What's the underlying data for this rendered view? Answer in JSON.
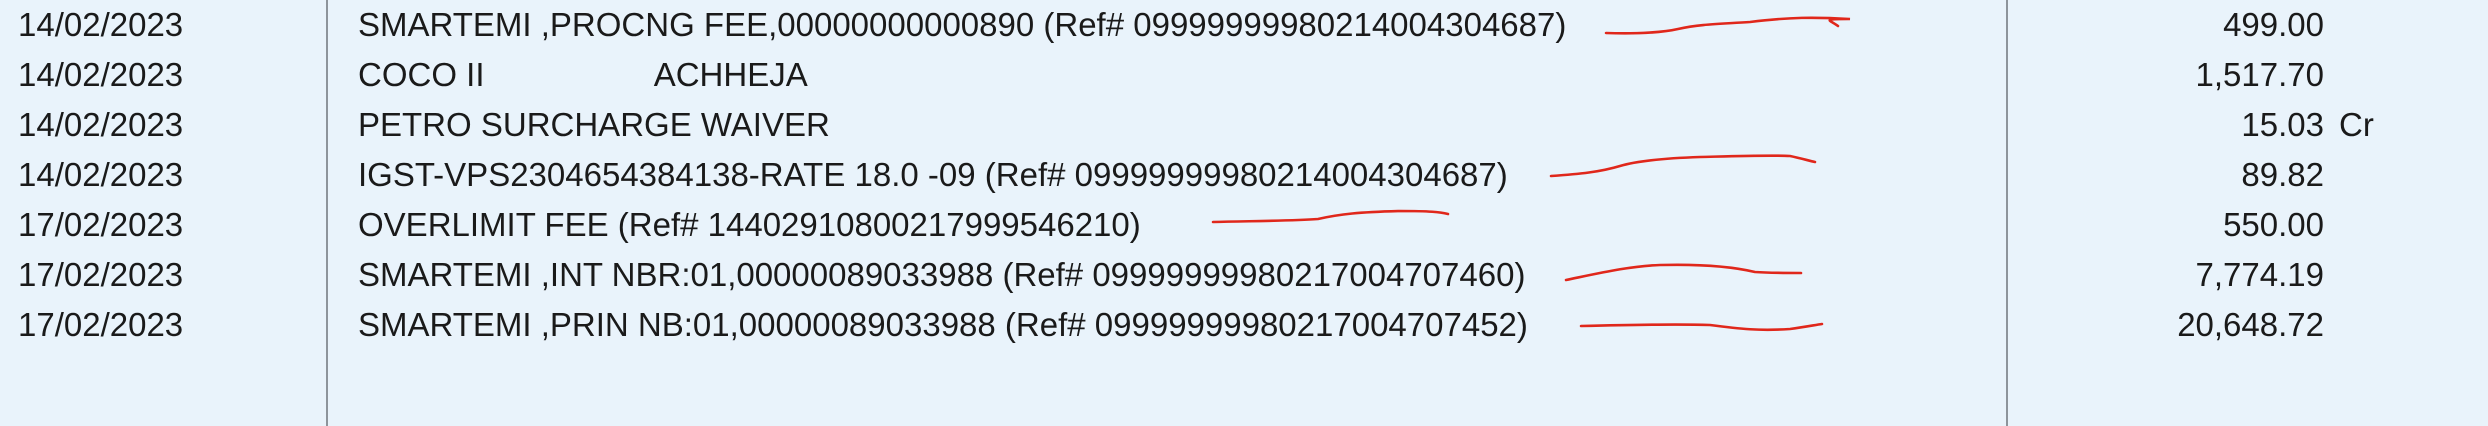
{
  "transactions": [
    {
      "date": "14/02/2023",
      "description": "SMARTEMI ,PROCNG FEE,00000000000890 (Ref# 09999999980214004304687)",
      "description_extra": "",
      "amount": "499.00",
      "cr_dr": ""
    },
    {
      "date": "14/02/2023",
      "description": "COCO II",
      "description_extra": "ACHHEJA",
      "amount": "1,517.70",
      "cr_dr": ""
    },
    {
      "date": "14/02/2023",
      "description": "PETRO SURCHARGE WAIVER",
      "description_extra": "",
      "amount": "15.03",
      "cr_dr": "Cr"
    },
    {
      "date": "14/02/2023",
      "description": "IGST-VPS2304654384138-RATE 18.0 -09 (Ref# 09999999980214004304687)",
      "description_extra": "",
      "amount": "89.82",
      "cr_dr": ""
    },
    {
      "date": "17/02/2023",
      "description": "OVERLIMIT FEE (Ref# 14402910800217999546210)",
      "description_extra": "",
      "amount": "550.00",
      "cr_dr": ""
    },
    {
      "date": "17/02/2023",
      "description": "SMARTEMI ,INT NBR:01,00000089033988 (Ref# 09999999980217004707460)",
      "description_extra": "",
      "amount": "7,774.19",
      "cr_dr": ""
    },
    {
      "date": "17/02/2023",
      "description": "SMARTEMI ,PRIN NB:01,00000089033988 (Ref# 09999999980217004707452)",
      "description_extra": "",
      "amount": "20,648.72",
      "cr_dr": ""
    }
  ],
  "colors": {
    "background": "#e9f3fb",
    "divider": "#8d949b",
    "annotation": "#e0271b"
  }
}
